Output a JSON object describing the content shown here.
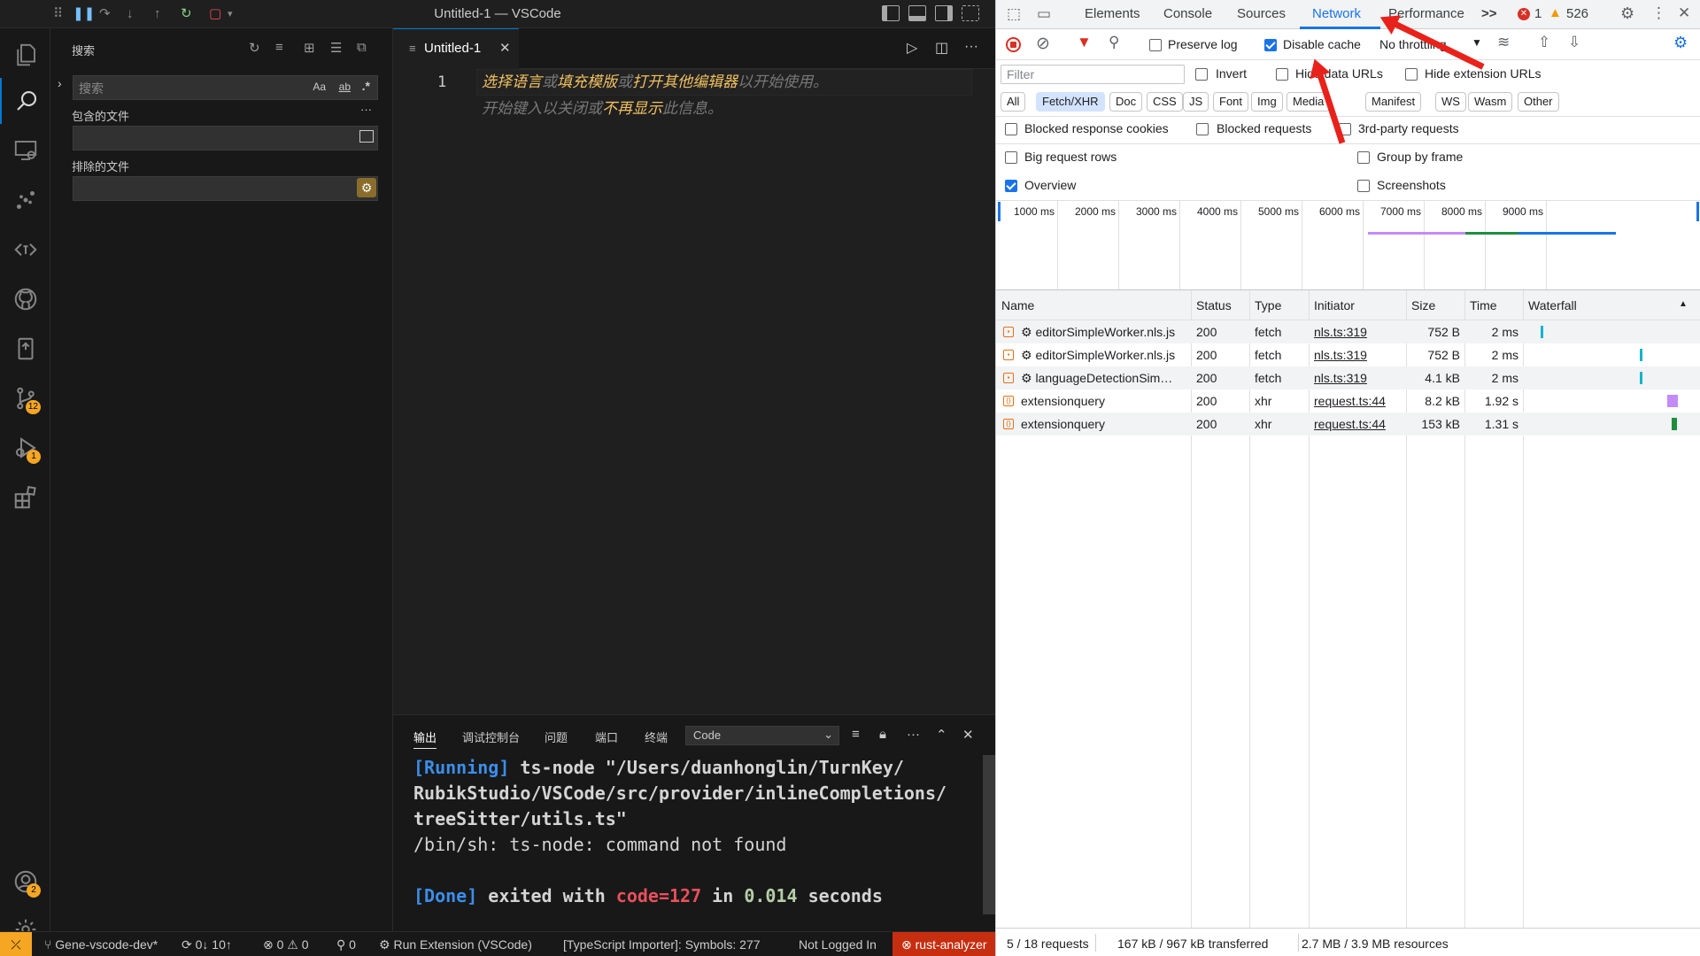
{
  "window": {
    "title": "Untitled-1 — VSCode"
  },
  "activity": {
    "badges": {
      "source_control": "12",
      "run_debug": "1",
      "accounts": "2"
    }
  },
  "sidebar": {
    "title": "搜索",
    "search_placeholder": "搜索",
    "match_case": "Aa",
    "match_word": "ab",
    "regex": ".*",
    "include_label": "包含的文件",
    "exclude_label": "排除的文件",
    "more": "···"
  },
  "editor": {
    "tab_label": "Untitled-1",
    "line_number": "1",
    "hint1": [
      "选择语言",
      "或",
      "填充模版",
      "或",
      "打开其他编辑器",
      "以开始使用。"
    ],
    "hint2": [
      "开始键入以关闭或",
      "不再显示",
      "此信息。"
    ]
  },
  "panel": {
    "tabs": [
      "输出",
      "调试控制台",
      "问题",
      "端口",
      "终端"
    ],
    "select_value": "Code",
    "terminal": {
      "running_tag": "[Running]",
      "running_cmd_1": "ts-node \"/Users/duanhonglin/TurnKey/",
      "running_cmd_2": "RubikStudio/VSCode/src/provider/inlineCompletions/",
      "running_cmd_3": "treeSitter/utils.ts\"",
      "error_line": "/bin/sh: ts-node: command not found",
      "done_tag": "[Done]",
      "done_text_1": "exited with",
      "done_code": "code=127",
      "done_text_2": "in",
      "done_time": "0.014",
      "done_text_3": "seconds"
    }
  },
  "statusbar": {
    "branch": "Gene-vscode-dev*",
    "sync": "0↓ 10↑",
    "problems": "⊗ 0 ⚠ 0",
    "ports": "0",
    "run": "Run Extension (VSCode)",
    "importer": "[TypeScript Importer]: Symbols: 277",
    "login": "Not Logged In",
    "rust": "rust-analyzer"
  },
  "devtools": {
    "tabs": [
      "Elements",
      "Console",
      "Sources",
      "Network",
      "Performance"
    ],
    "active_tab": "Network",
    "more_tabs": ">>",
    "errors": "1",
    "warnings": "526",
    "toolbar": {
      "preserve_log": "Preserve log",
      "disable_cache": "Disable cache",
      "throttling": "No throttling"
    },
    "filter": {
      "placeholder": "Filter",
      "invert": "Invert",
      "hide_data_urls": "Hide data URLs",
      "hide_extension_urls": "Hide extension URLs"
    },
    "chips": [
      "All",
      "Fetch/XHR",
      "Doc",
      "CSS",
      "JS",
      "Font",
      "Img",
      "Media",
      "Manifest",
      "WS",
      "Wasm",
      "Other"
    ],
    "active_chip": "Fetch/XHR",
    "options": {
      "blocked_cookies": "Blocked response cookies",
      "blocked_requests": "Blocked requests",
      "third_party": "3rd-party requests",
      "big_rows": "Big request rows",
      "group_frame": "Group by frame",
      "overview": "Overview",
      "screenshots": "Screenshots"
    },
    "timeline_ticks": [
      "1000 ms",
      "2000 ms",
      "3000 ms",
      "4000 ms",
      "5000 ms",
      "6000 ms",
      "7000 ms",
      "8000 ms",
      "9000 ms"
    ],
    "columns": [
      "Name",
      "Status",
      "Type",
      "Initiator",
      "Size",
      "Time",
      "Waterfall"
    ],
    "rows": [
      {
        "name": "⚙ editorSimpleWorker.nls.js",
        "status": "200",
        "type": "fetch",
        "initiator": "nls.ts:319",
        "size": "752 B",
        "time": "2 ms"
      },
      {
        "name": "⚙ editorSimpleWorker.nls.js",
        "status": "200",
        "type": "fetch",
        "initiator": "nls.ts:319",
        "size": "752 B",
        "time": "2 ms"
      },
      {
        "name": "⚙ languageDetectionSim…",
        "status": "200",
        "type": "fetch",
        "initiator": "nls.ts:319",
        "size": "4.1 kB",
        "time": "2 ms"
      },
      {
        "name": "extensionquery",
        "status": "200",
        "type": "xhr",
        "initiator": "request.ts:44",
        "size": "8.2 kB",
        "time": "1.92 s"
      },
      {
        "name": "extensionquery",
        "status": "200",
        "type": "xhr",
        "initiator": "request.ts:44",
        "size": "153 kB",
        "time": "1.31 s"
      }
    ],
    "footer": {
      "requests": "5 / 18 requests",
      "transferred": "167 kB / 967 kB transferred",
      "resources": "2.7 MB / 3.9 MB resources"
    }
  }
}
